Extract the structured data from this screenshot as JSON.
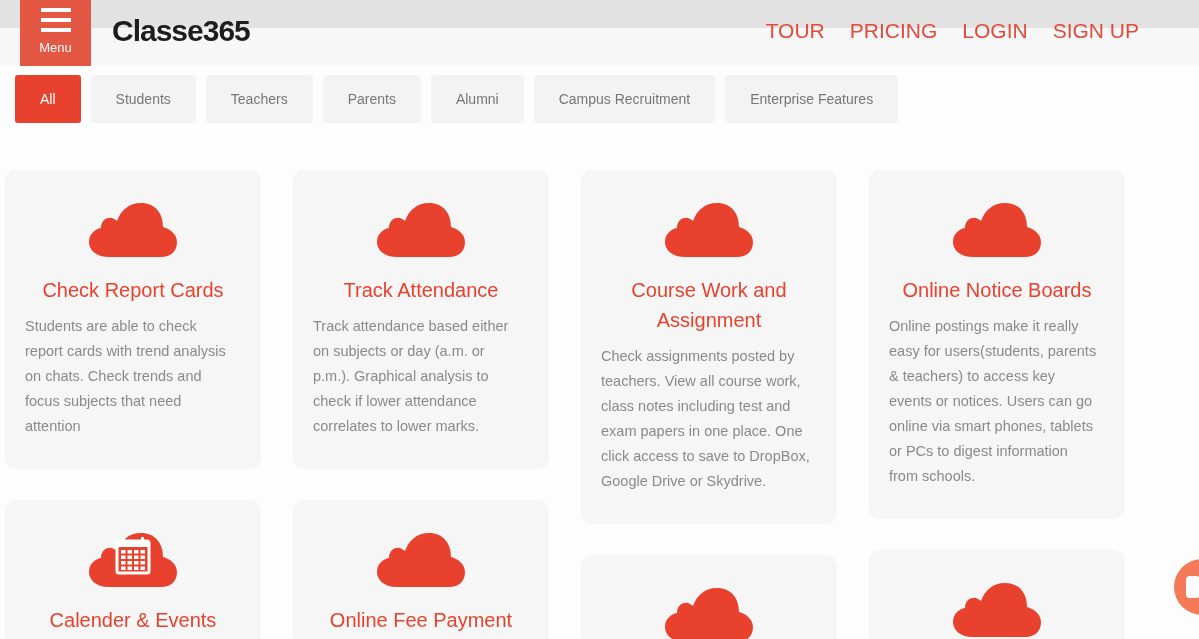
{
  "header": {
    "menu_label": "Menu",
    "logo": "Classe365",
    "nav": [
      "TOUR",
      "PRICING",
      "LOGIN",
      "SIGN UP"
    ]
  },
  "filters": [
    {
      "label": "All",
      "selected": true
    },
    {
      "label": "Students",
      "selected": false
    },
    {
      "label": "Teachers",
      "selected": false
    },
    {
      "label": "Parents",
      "selected": false
    },
    {
      "label": "Alumni",
      "selected": false
    },
    {
      "label": "Campus Recruitment",
      "selected": false
    },
    {
      "label": "Enterprise Features",
      "selected": false
    }
  ],
  "columns": [
    [
      {
        "kind": "cloud",
        "title": "Check Report Cards",
        "text": "Students are able to check report cards with trend analysis on chats. Check trends and focus subjects that need attention"
      },
      {
        "kind": "calendar",
        "title": "Calender & Events"
      }
    ],
    [
      {
        "kind": "cloud",
        "title": "Track Attendance",
        "text": "Track attendance based either on subjects or day (a.m. or p.m.). Graphical analysis to check if lower attendance correlates to lower marks."
      },
      {
        "kind": "cloud",
        "title": "Online Fee Payment"
      }
    ],
    [
      {
        "kind": "cloud",
        "title": "Course Work and Assignment",
        "text": "Check assignments posted by teachers. View all course work, class notes including test and exam papers in one place. One click access to save to DropBox, Google Drive or Skydrive."
      },
      {
        "kind": "cloud"
      }
    ],
    [
      {
        "kind": "cloud",
        "title": "Online Notice Boards",
        "text": "Online postings make it really easy for users(students, parents & teachers) to access key events or notices. Users can go online via smart phones, tablets or PCs to digest information from schools."
      },
      {
        "kind": "cloud"
      }
    ]
  ]
}
